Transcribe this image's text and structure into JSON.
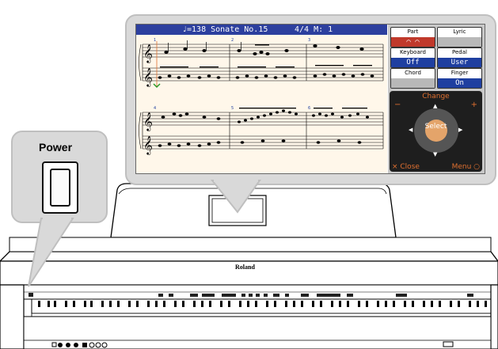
{
  "screen": {
    "title": "♩=138 Sonate No.15",
    "time_signature": "4/4  M:  1"
  },
  "panel": {
    "part": {
      "label": "Part",
      "value": "⌒ ⌒"
    },
    "lyric": {
      "label": "Lyric",
      "value": ""
    },
    "keyboard": {
      "label": "Keyboard",
      "value": "Off"
    },
    "pedal": {
      "label": "Pedal",
      "value": "User"
    },
    "chord": {
      "label": "Chord",
      "value": ""
    },
    "finger": {
      "label": "Finger",
      "value": "On"
    },
    "change_label": "Change",
    "select_label": "Select",
    "close_label": "× Close",
    "menu_label": "Menu ○"
  },
  "power_label": "Power",
  "brand": "Roland",
  "colors": {
    "title_bar": "#2c3f9e",
    "panel_active": "#c0392b",
    "panel_value": "#1f3fa0",
    "callout_fill": "#d9d9d9"
  }
}
